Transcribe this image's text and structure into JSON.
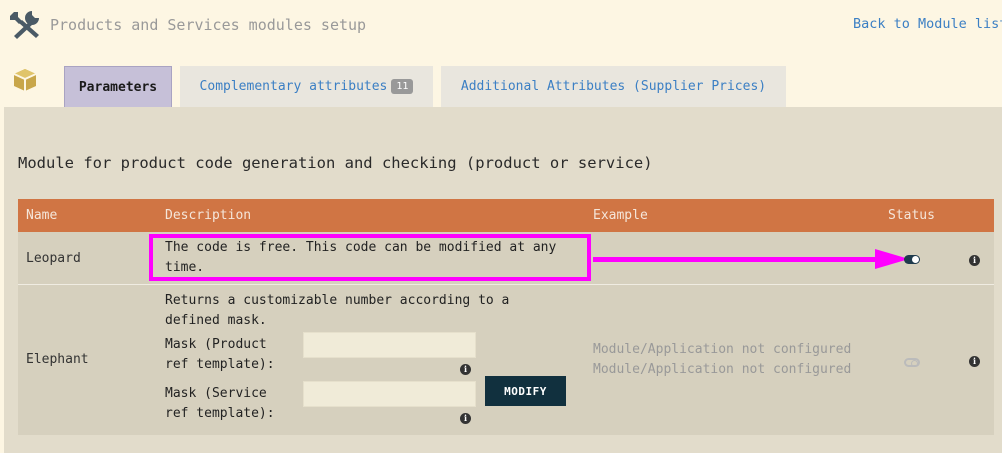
{
  "header": {
    "title": "Products and Services modules setup",
    "back_link": "Back to Module list",
    "icon": "tools-icon"
  },
  "tabs": [
    {
      "label": "Parameters",
      "active": true
    },
    {
      "label": "Complementary attributes",
      "badge": "11"
    },
    {
      "label": "Additional Attributes (Supplier Prices)"
    }
  ],
  "section": {
    "title": "Module for product code generation and checking (product or service)"
  },
  "table": {
    "columns": [
      "Name",
      "Description",
      "Example",
      "Status"
    ],
    "rows": [
      {
        "name": "Leopard",
        "description_line1": "The code is free. This code can be modified at any",
        "description_line2": "time.",
        "status": "enabled"
      },
      {
        "name": "Elephant",
        "description_line1": "Returns a customizable number according to a",
        "description_line2": "defined mask.",
        "mask_product_line1": "Mask (Product",
        "mask_product_line2": "ref template):",
        "mask_product_value": "",
        "mask_service_line1": "Mask (Service",
        "mask_service_line2": "ref template):",
        "mask_service_value": "",
        "modify_label": "MODIFY",
        "example_line1": "Module/Application not configured",
        "example_line2": "Module/Application not configured",
        "status": "disabled"
      }
    ]
  },
  "colors": {
    "header_bg": "#d07544",
    "active_tab": "#c6c0d8",
    "highlight": "#ff00ff",
    "button": "#11303e",
    "link": "#3b7fc4"
  }
}
